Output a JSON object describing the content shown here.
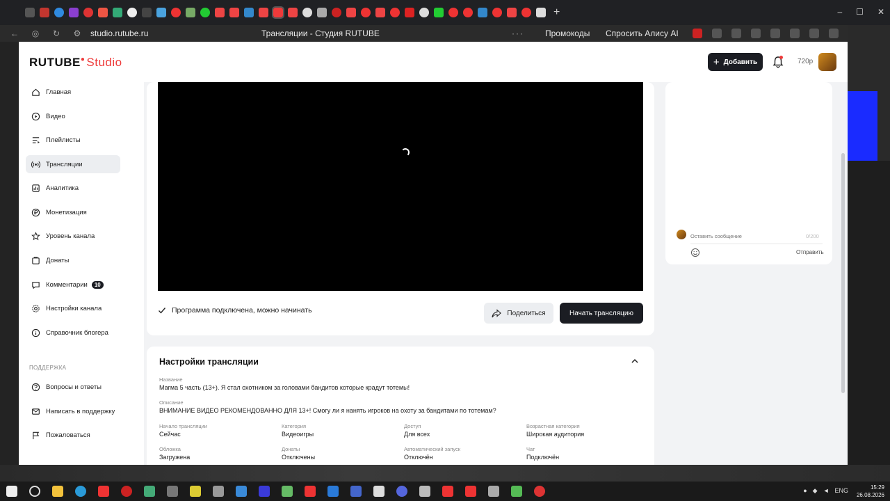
{
  "browser": {
    "address": "studio.rutube.ru",
    "page_title": "Трансляции - Студия RUTUBE",
    "promo_label": "Промокоды",
    "alice_label": "Спросить Алису AI"
  },
  "header": {
    "logo_main": "RUTUBE",
    "logo_suffix": "Studio",
    "add_label": "Добавить",
    "quality": "720p"
  },
  "sidebar": {
    "items": [
      {
        "label": "Главная"
      },
      {
        "label": "Видео"
      },
      {
        "label": "Плейлисты"
      },
      {
        "label": "Трансляции"
      },
      {
        "label": "Аналитика"
      },
      {
        "label": "Монетизация"
      },
      {
        "label": "Уровень канала"
      },
      {
        "label": "Донаты"
      },
      {
        "label": "Комментарии",
        "badge": "10"
      },
      {
        "label": "Настройки канала"
      },
      {
        "label": "Справочник блогера"
      }
    ],
    "support_title": "ПОДДЕРЖКА",
    "support_items": [
      {
        "label": "Вопросы и ответы"
      },
      {
        "label": "Написать в поддержку"
      },
      {
        "label": "Пожаловаться"
      }
    ]
  },
  "stream": {
    "status": "Программа подключена, можно начинать",
    "share_label": "Поделиться",
    "start_label": "Начать трансляцию"
  },
  "settings": {
    "title": "Настройки трансляции",
    "name_label": "Название",
    "name_value": "Магма 5 часть (13+). Я стал охотником за головами бандитов которые крадут тотемы!",
    "desc_label": "Описание",
    "desc_value": "ВНИМАНИЕ ВИДЕО РЕКОМЕНДОВАННО ДЛЯ 13+! Смогу ли я нанять игроков на охоту за бандитами по тотемам?",
    "fields_row1": [
      {
        "label": "Начало трансляции",
        "value": "Сейчас"
      },
      {
        "label": "Категория",
        "value": "Видеоигры"
      },
      {
        "label": "Доступ",
        "value": "Для всех"
      },
      {
        "label": "Возрастная категория",
        "value": "Широкая аудитория"
      }
    ],
    "fields_row2": [
      {
        "label": "Обложка",
        "value": "Загружена"
      },
      {
        "label": "Донаты",
        "value": "Отключены"
      },
      {
        "label": "Автоматический запуск",
        "value": "Отключён"
      },
      {
        "label": "Чат",
        "value": "Подключён"
      }
    ]
  },
  "chat": {
    "placeholder": "Оставить сообщение",
    "counter": "0/200",
    "send_label": "Отправить"
  },
  "taskbar": {
    "lang": "ENG",
    "time": "15:29",
    "date": "26.08.2026"
  },
  "colors": {
    "accent": "#ee3a3a",
    "dark_button": "#1b1d23",
    "background": "#f2f3f5"
  }
}
